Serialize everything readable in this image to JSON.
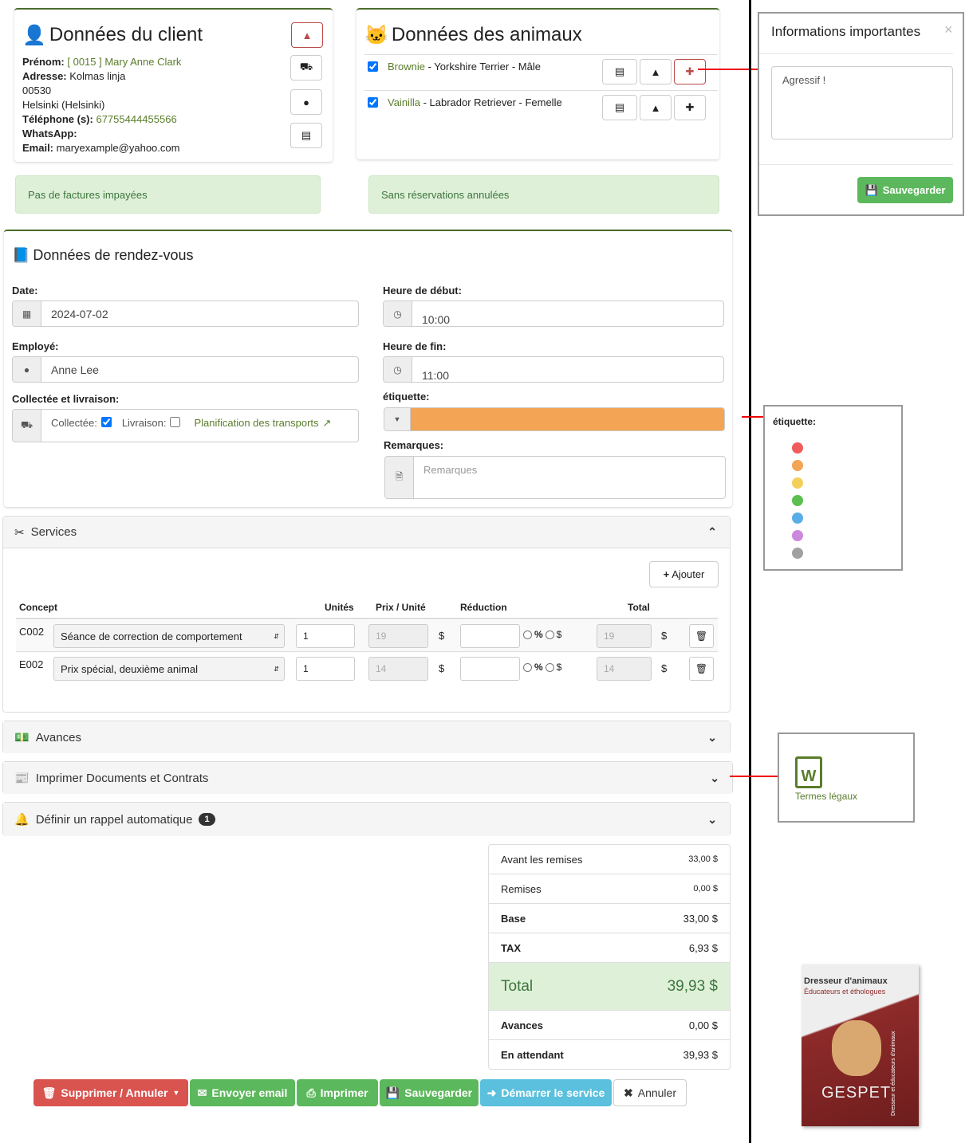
{
  "client": {
    "title": "Données du client",
    "prenom_label": "Prénom:",
    "prenom": "[ 0015 ] Mary Anne Clark",
    "adresse_label": "Adresse:",
    "adresse": "Kolmas linja",
    "postal": "00530",
    "city": "Helsinki (Helsinki)",
    "tel_label": "Téléphone (s):",
    "tel": "67755444455566",
    "whatsapp_label": "WhatsApp:",
    "email_label": "Email:",
    "email": "maryexample@yahoo.com"
  },
  "animals": {
    "title": "Données des animaux",
    "items": [
      {
        "name": "Brownie",
        "desc": " - Yorkshire Terrier - Mâle",
        "checked": true
      },
      {
        "name": "Vainilla",
        "desc": " - Labrador Retriever - Femelle",
        "checked": true
      }
    ]
  },
  "alerts": {
    "invoices": "Pas de factures impayées",
    "reservations": "Sans réservations annulées"
  },
  "info_modal": {
    "title": "Informations importantes",
    "text": "Agressif !",
    "save": "Sauvegarder"
  },
  "appointment": {
    "title": "Données de rendez-vous",
    "date_label": "Date:",
    "date": "2024-07-02",
    "start_label": "Heure de début:",
    "start": "10:00",
    "employee_label": "Employé:",
    "employee": "Anne Lee",
    "end_label": "Heure de fin:",
    "end": "11:00",
    "pickup_label": "Collectée et livraison:",
    "collected_label": "Collectée:",
    "collected": true,
    "delivery_label": "Livraison:",
    "delivery": false,
    "transport_link": "Planification des transports",
    "tag_label": "étiquette:",
    "tag_color": "#f4a455",
    "remarks_label": "Remarques:",
    "remarks_placeholder": "Remarques"
  },
  "services": {
    "title": "Services",
    "add": "Ajouter",
    "headers": [
      "Concept",
      "Unités",
      "Prix / Unité",
      "Réduction",
      "Total"
    ],
    "rows": [
      {
        "code": "C002",
        "concept": "Séance de correction de comportement",
        "units": "1",
        "price": "19",
        "total": "19"
      },
      {
        "code": "E002",
        "concept": "Prix spécial, deuxième animal",
        "units": "1",
        "price": "14",
        "total": "14"
      }
    ],
    "pct": "%",
    "cur": "$"
  },
  "sections": {
    "advances": "Avances",
    "print": "Imprimer Documents et Contrats",
    "reminder": "Définir un rappel automatique",
    "reminder_badge": "1"
  },
  "totals": [
    {
      "label": "Avant les remises",
      "value": "33,00 $"
    },
    {
      "label": "Remises",
      "value": "0,00 $"
    },
    {
      "label": "Base",
      "value": "33,00 $"
    },
    {
      "label": "TAX",
      "value": "6,93 $"
    },
    {
      "label": "Total",
      "value": "39,93 $"
    },
    {
      "label": "Avances",
      "value": "0,00 $"
    },
    {
      "label": "En attendant",
      "value": "39,93 $"
    }
  ],
  "buttons": {
    "delete": "Supprimer  /  Annuler",
    "email": "Envoyer email",
    "print": "Imprimer",
    "save": "Sauvegarder",
    "start": "Démarrer le service",
    "cancel": "Annuler"
  },
  "tag_panel": {
    "title": "étiquette:",
    "colors": [
      "#f05b5b",
      "#f4a455",
      "#f4cf5a",
      "#5bbf4f",
      "#5aaee8",
      "#cc88dd",
      "#a0a0a0"
    ]
  },
  "legal": {
    "label": "Termes légaux"
  },
  "product": {
    "title": "Dresseur d'animaux",
    "subtitle": "Éducateurs et éthologues",
    "brand": "GESPET",
    "side": "Dresseur et éducateurs d'animaux"
  }
}
